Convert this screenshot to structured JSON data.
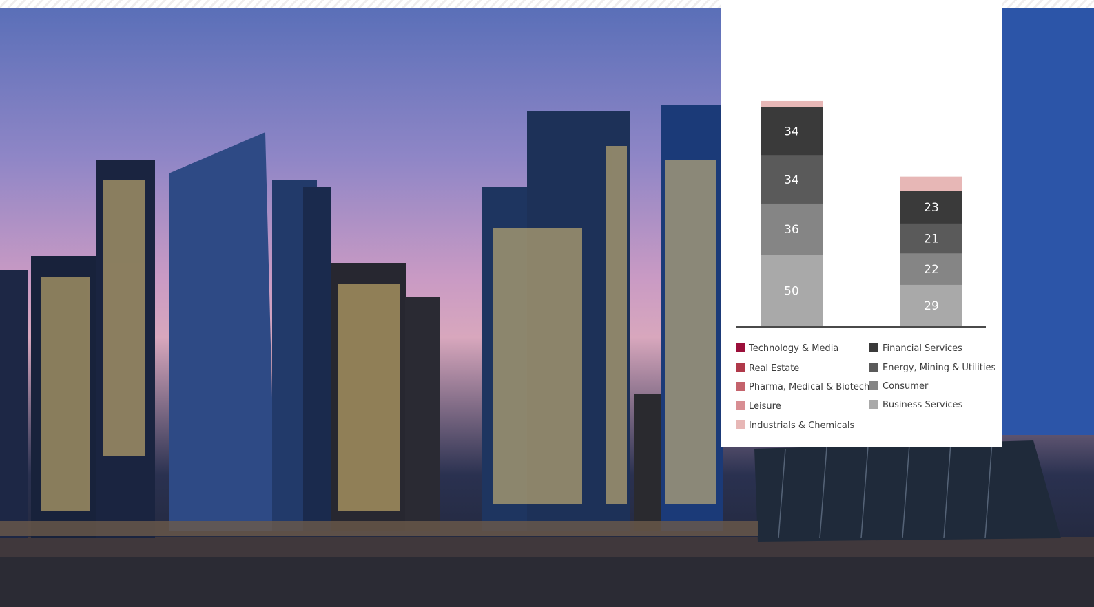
{
  "colors": {
    "technology_media": "#9b0f3a",
    "real_estate": "#b0394a",
    "pharma": "#c4636c",
    "leisure": "#d88e93",
    "industrials": "#e7b7b6",
    "financial": "#3a3a3a",
    "energy": "#5a5a5a",
    "consumer": "#858585",
    "business": "#a9a9a9"
  },
  "chart_data": {
    "type": "bar",
    "stacked": true,
    "categories": [
      "",
      ""
    ],
    "series": [
      {
        "name": "Business Services",
        "color": "#a9a9a9",
        "values": [
          50,
          29
        ]
      },
      {
        "name": "Consumer",
        "color": "#858585",
        "values": [
          36,
          22
        ]
      },
      {
        "name": "Energy, Mining & Utilities",
        "color": "#5a5a5a",
        "values": [
          34,
          21
        ]
      },
      {
        "name": "Financial Services",
        "color": "#3a3a3a",
        "values": [
          34,
          23
        ]
      },
      {
        "name": "Industrials & Chemicals",
        "color": "#e7b7b6",
        "values": [
          4,
          10
        ]
      }
    ],
    "visible_labels": [
      [
        "50",
        "36",
        "34",
        "34"
      ],
      [
        "29",
        "22",
        "21",
        "23"
      ]
    ],
    "legend": {
      "left": [
        "Technology & Media",
        "Real Estate",
        "Pharma, Medical & Biotech",
        "Leisure",
        "Industrials & Chemicals"
      ],
      "right": [
        "Financial Services",
        "Energy, Mining & Utilities",
        "Consumer",
        "Business Services"
      ]
    },
    "legend_colors": {
      "left": [
        "#9b0f3a",
        "#b0394a",
        "#c4636c",
        "#d88e93",
        "#e7b7b6"
      ],
      "right": [
        "#3a3a3a",
        "#5a5a5a",
        "#858585",
        "#a9a9a9"
      ]
    },
    "legend_position": "bottom",
    "grid": false
  }
}
